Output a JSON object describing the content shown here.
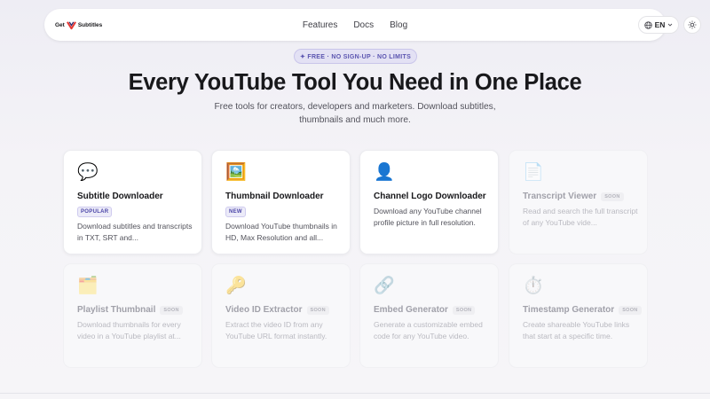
{
  "nav": {
    "logo_text": "Get",
    "logo_text2": "Subtitles",
    "links": [
      "Features",
      "Docs",
      "Blog"
    ],
    "language": "EN",
    "icons": {
      "globe": "globe-icon",
      "chevron": "chevron-down-icon",
      "theme": "sun-icon"
    }
  },
  "hero": {
    "pill": "✦ FREE · NO SIGN-UP · NO LIMITS",
    "title": "Every YouTube Tool You Need in One Place",
    "subtitle": "Free tools for creators, developers and marketers. Download subtitles, thumbnails and much more."
  },
  "colors": {
    "accent": "#5b55b0",
    "youtube": "#e53935"
  },
  "tools": [
    {
      "emoji": "💬",
      "icon": "speech-bubble-icon",
      "title": "Subtitle Downloader",
      "badge": "POPULAR",
      "desc": "Download subtitles and transcripts in TXT, SRT and...",
      "soon": false
    },
    {
      "emoji": "🖼️",
      "icon": "framed-picture-icon",
      "title": "Thumbnail Downloader",
      "badge": "NEW",
      "desc": "Download YouTube thumbnails in HD, Max Resolution and all...",
      "soon": false
    },
    {
      "emoji": "👤",
      "icon": "user-silhouette-icon",
      "title": "Channel Logo Downloader",
      "badge": "",
      "desc": "Download any YouTube channel profile picture in full resolution.",
      "soon": false
    },
    {
      "emoji": "📄",
      "icon": "document-icon",
      "title": "Transcript Viewer",
      "badge": "SOON",
      "desc": "Read and search the full transcript of any YouTube vide...",
      "soon": true
    },
    {
      "emoji": "🗂️",
      "icon": "folder-icon",
      "title": "Playlist Thumbnail",
      "badge": "SOON",
      "desc": "Download thumbnails for every video in a YouTube playlist at...",
      "soon": true
    },
    {
      "emoji": "🔑",
      "icon": "key-icon",
      "title": "Video ID Extractor",
      "badge": "SOON",
      "desc": "Extract the video ID from any YouTube URL format instantly.",
      "soon": true
    },
    {
      "emoji": "🔗",
      "icon": "link-icon",
      "title": "Embed Generator",
      "badge": "SOON",
      "desc": "Generate a customizable embed code for any YouTube video.",
      "soon": true
    },
    {
      "emoji": "⏱️",
      "icon": "stopwatch-icon",
      "title": "Timestamp Generator",
      "badge": "SOON",
      "desc": "Create shareable YouTube links that start at a specific time.",
      "soon": true
    }
  ]
}
